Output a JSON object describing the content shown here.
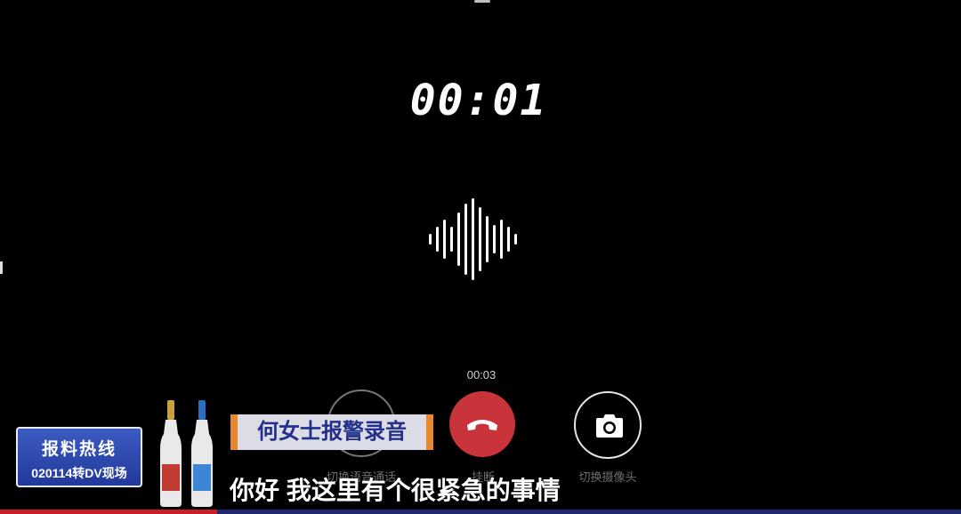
{
  "call": {
    "timer": "00:01",
    "small_timer": "00:03"
  },
  "controls": {
    "switch_voice_label": "切换语音通话",
    "hangup_label": "挂断",
    "switch_camera_label": "切换摄像头",
    "hangup_color": "#c8343a"
  },
  "broadcast": {
    "hotline_title": "报料热线",
    "hotline_number": "020114转DV现场",
    "caller_label": "何女士报警录音",
    "subtitle": "你好 我这里有个很紧急的事情",
    "accent_orange": "#e8872c",
    "accent_blue": "#22399a"
  },
  "icons": {
    "voice": "switch-voice-icon",
    "hangup": "phone-hangup-icon",
    "camera": "camera-icon",
    "waveform": "audio-waveform-icon"
  }
}
